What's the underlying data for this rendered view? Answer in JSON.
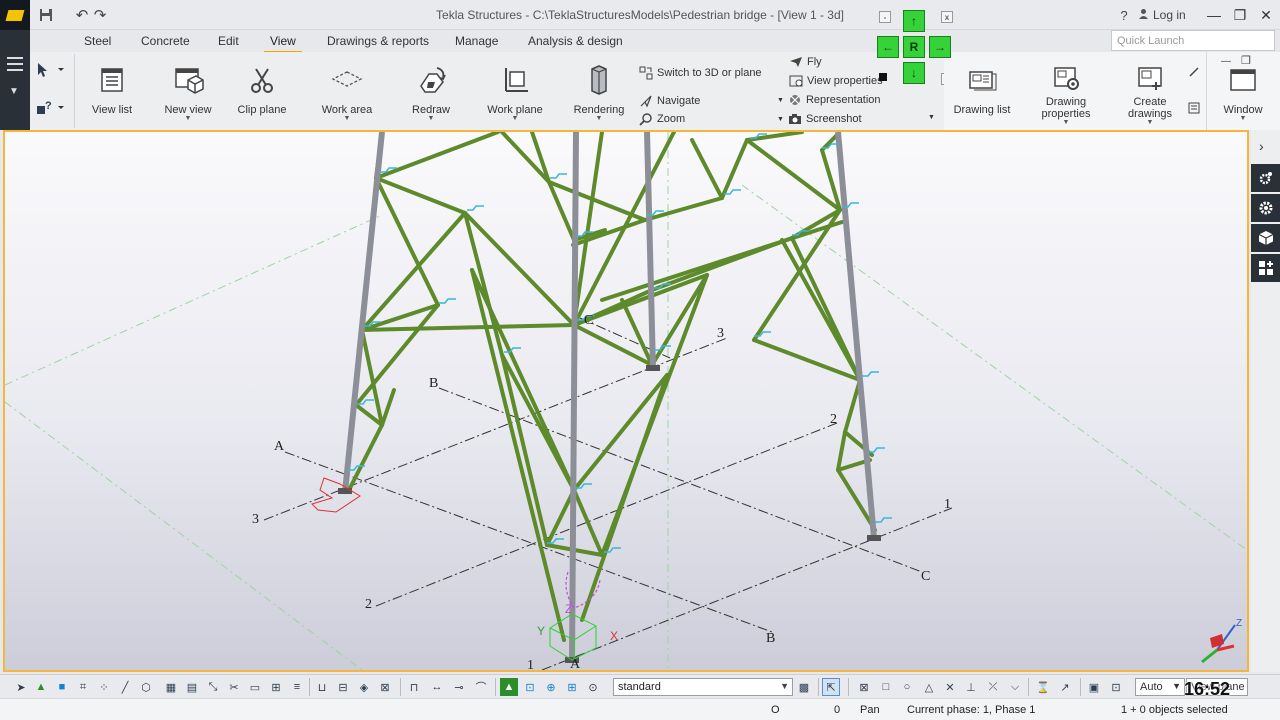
{
  "app": {
    "title": "Tekla Structures - C:\\TeklaStructuresModels\\Pedestrian bridge  - [View 1 - 3d]",
    "login_label": "Log in",
    "quick_launch_placeholder": "Quick Launch"
  },
  "navpad": {
    "up": "↑",
    "left": "←",
    "center": "R",
    "right": "→",
    "down": "↓",
    "minimize": "-",
    "close": "x",
    "help": "?"
  },
  "tabs": [
    "Steel",
    "Concrete",
    "Edit",
    "View",
    "Drawings & reports",
    "Manage",
    "Analysis & design"
  ],
  "active_tab": "View",
  "ribbon": {
    "buttons": [
      {
        "label": "View list",
        "icon": "view-list-icon"
      },
      {
        "label": "New view",
        "icon": "new-view-icon"
      },
      {
        "label": "Clip plane",
        "icon": "scissors-icon"
      },
      {
        "label": "Work area",
        "icon": "work-area-icon"
      },
      {
        "label": "Redraw",
        "icon": "redraw-icon"
      },
      {
        "label": "Work plane",
        "icon": "work-plane-icon"
      },
      {
        "label": "Rendering",
        "icon": "rendering-icon"
      }
    ],
    "small_items": [
      {
        "label": "Switch to 3D or plane",
        "icon": "switch-3d-icon"
      },
      {
        "label": "Navigate",
        "icon": "navigate-icon"
      },
      {
        "label": "Zoom",
        "icon": "zoom-icon"
      },
      {
        "label": "Fly",
        "icon": "fly-icon"
      },
      {
        "label": "View properties",
        "icon": "view-properties-icon"
      },
      {
        "label": "Representation",
        "icon": "representation-icon"
      },
      {
        "label": "Screenshot",
        "icon": "camera-icon"
      }
    ],
    "right_buttons": [
      {
        "label": "Drawing list",
        "icon": "drawing-list-icon"
      },
      {
        "label": "Drawing\nproperties",
        "l1": "Drawing",
        "l2": "properties",
        "icon": "drawing-properties-icon"
      },
      {
        "label": "Create\ndrawings",
        "l1": "Create",
        "l2": "drawings",
        "icon": "create-drawings-icon"
      },
      {
        "label": "Window",
        "icon": "window-icon"
      }
    ]
  },
  "viewport": {
    "grid_labels_letters": [
      "A",
      "B",
      "C",
      "A",
      "B",
      "C"
    ],
    "grid_labels_numbers": [
      "3",
      "2",
      "1",
      "3",
      "2",
      "1"
    ],
    "axis_labels": {
      "x": "X",
      "y": "Y",
      "z": "Z"
    },
    "grid_extra_label": "C",
    "colors": {
      "member_green": "#5d8a2a",
      "column_gray": "#8d8f98",
      "highlight": "#f5b63c"
    }
  },
  "toolbar": {
    "filter_value": "standard",
    "zoom_value": "Auto",
    "plane_value": "View plane"
  },
  "clock": "16:52",
  "status": {
    "snap_o": "O",
    "count": "0",
    "mode": "Pan",
    "phase": "Current phase: 1, Phase 1",
    "selection": "1 + 0 objects selected"
  }
}
